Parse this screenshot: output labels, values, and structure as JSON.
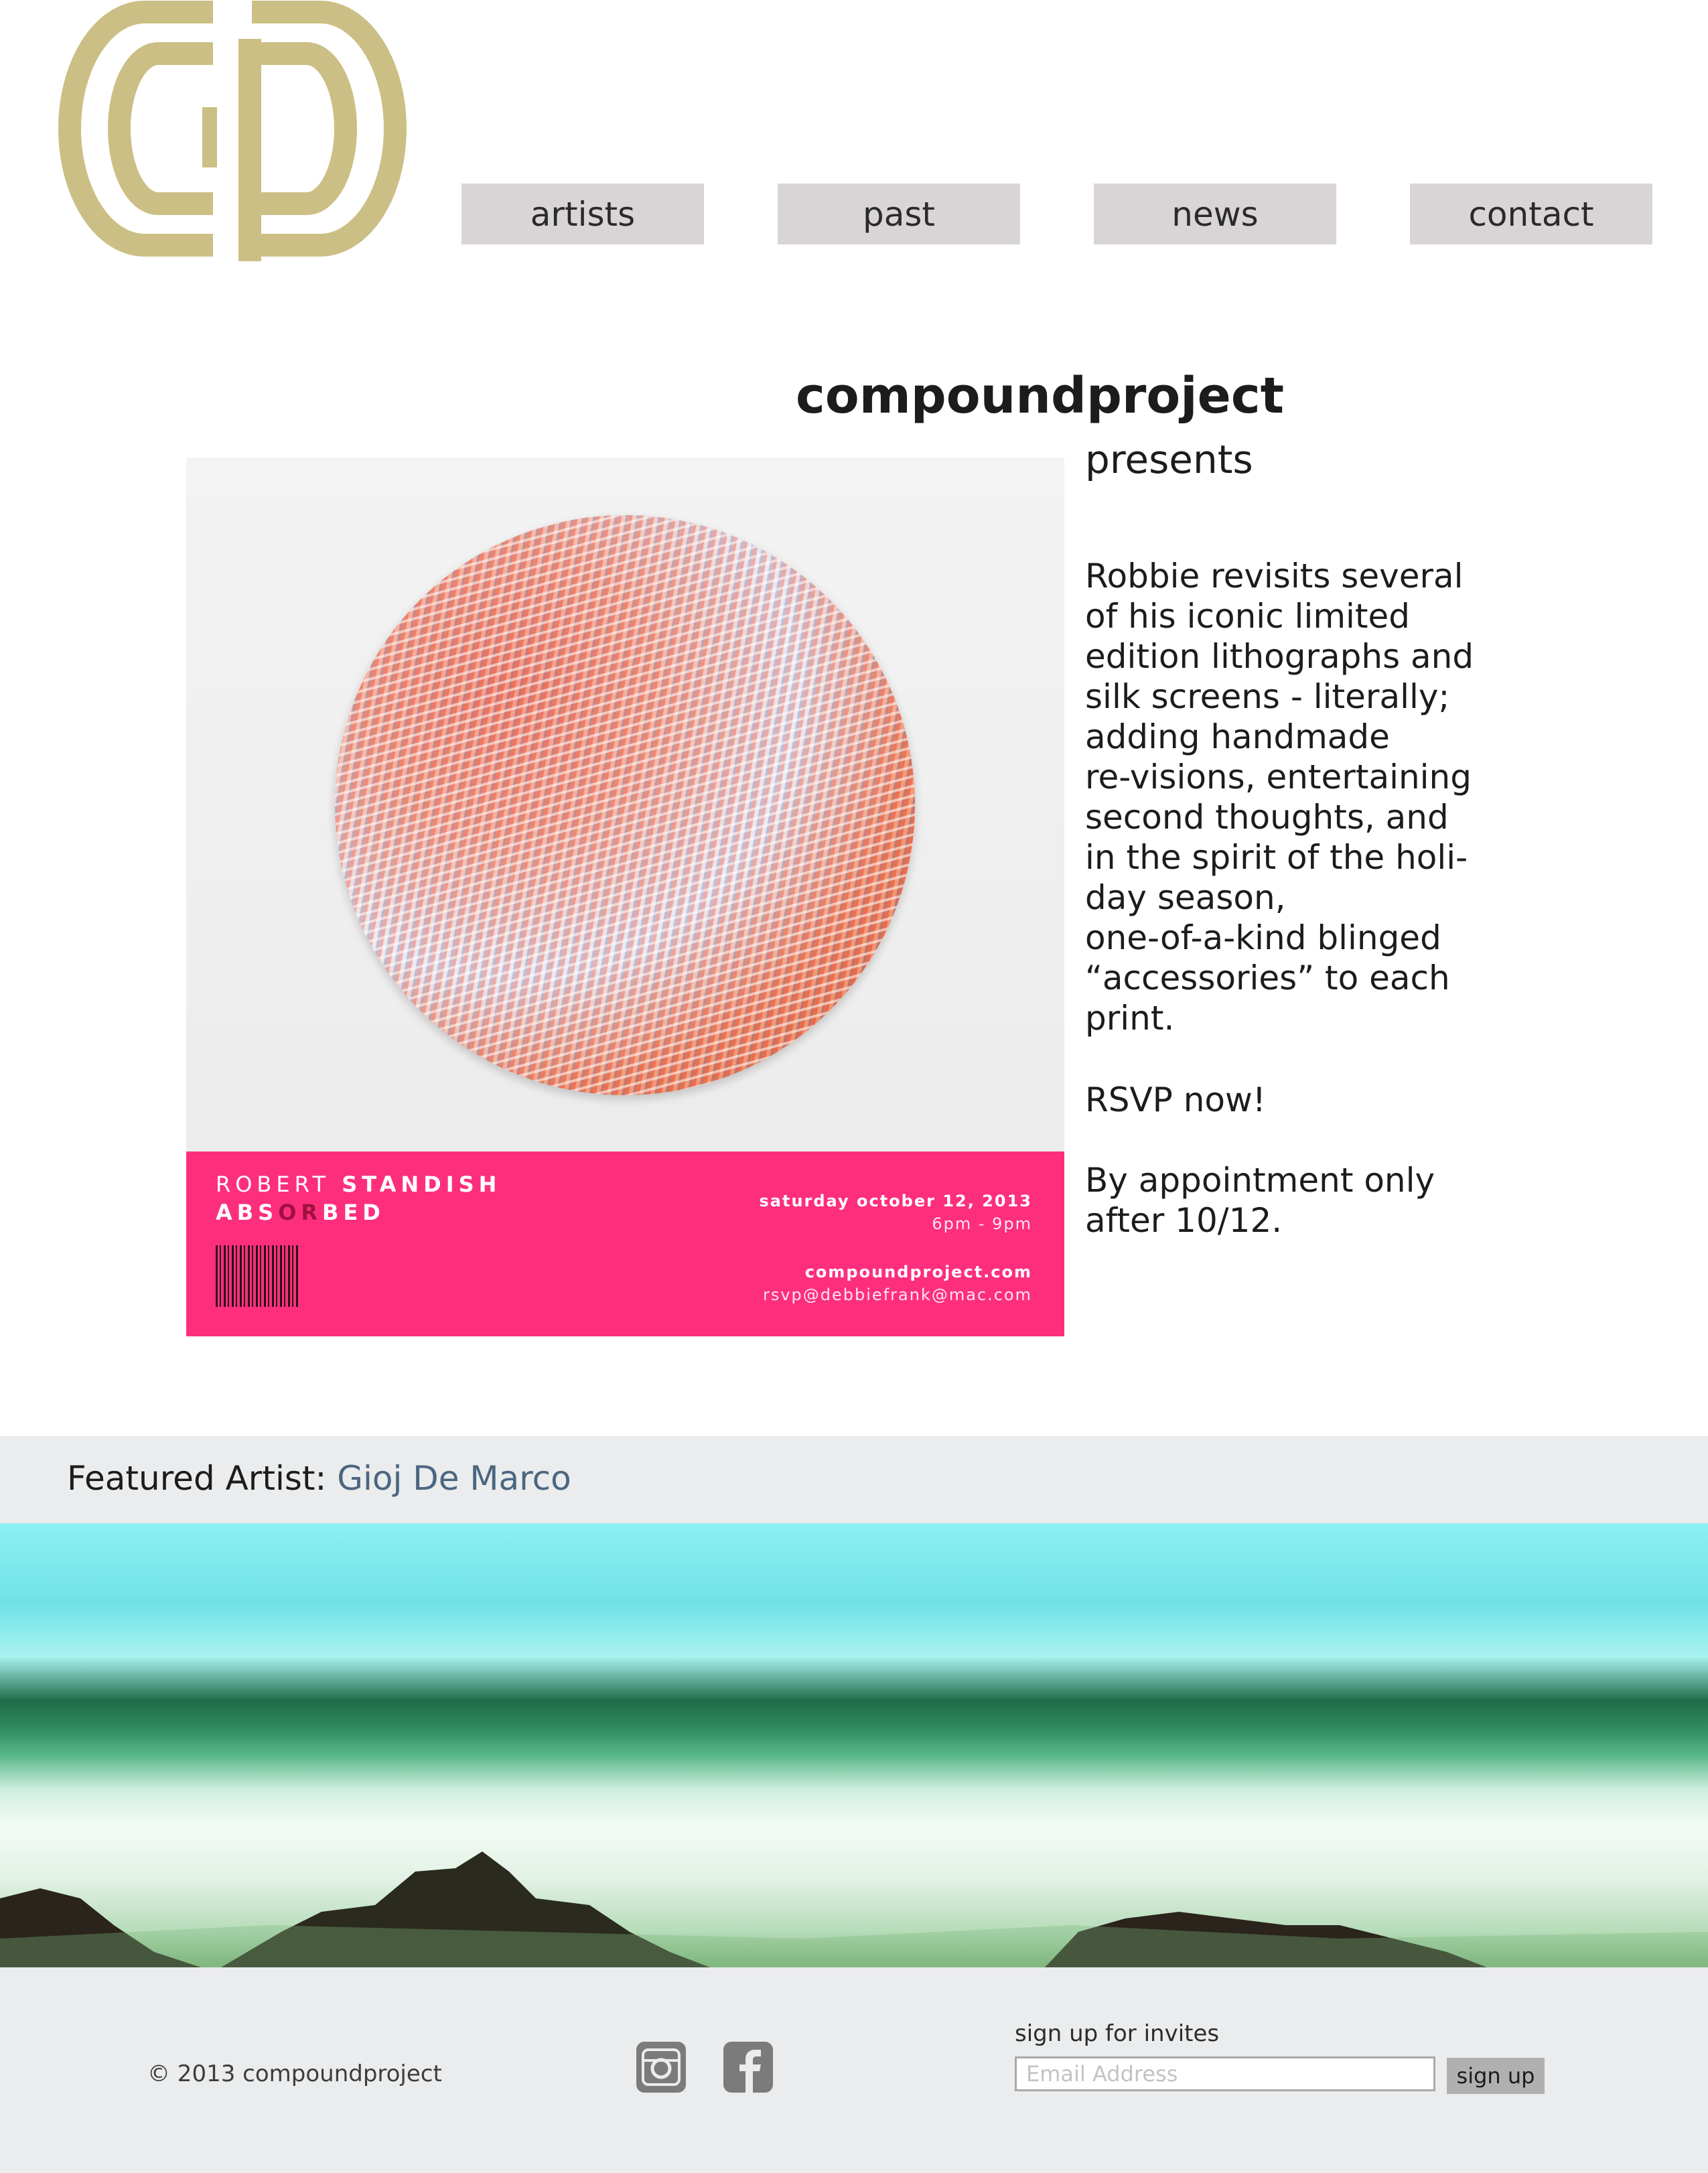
{
  "colors": {
    "logo": "#cbbf85",
    "nav_bg": "#d9d5d6",
    "accent_pink": "#fd2f7d",
    "featured_link": "#4c6680",
    "footer_bg": "#eaeced"
  },
  "logo": {
    "icon": "compoundproject-logo"
  },
  "nav": {
    "items": [
      {
        "label": "artists"
      },
      {
        "label": "past"
      },
      {
        "label": "news"
      },
      {
        "label": "contact"
      }
    ]
  },
  "hero": {
    "title": "compoundproject",
    "subtitle": "presents",
    "description": [
      "Robbie revisits several",
      "of his iconic limited",
      "edition lithographs and",
      "silk screens - literally;",
      "adding handmade",
      "re-visions, entertaining",
      "second thoughts, and",
      "in the spirit of the holi-",
      "day season,",
      "one-of-a-kind blinged",
      "“accessories” to each",
      "print."
    ],
    "rsvp": "RSVP now!",
    "appointment": [
      "By appointment only",
      "after 10/12."
    ]
  },
  "artwork": {
    "artist_first": "ROBERT",
    "artist_last": "STANDISH",
    "show_pre": "ABS",
    "show_mid": "OR",
    "show_post": "BED",
    "date": "saturday october 12, 2013",
    "time": "6pm - 9pm",
    "site": "compoundproject.com",
    "rsvp_email": "rsvp@debbiefrank@mac.com"
  },
  "featured": {
    "label": "Featured Artist:",
    "artist": "Gioj De Marco"
  },
  "footer": {
    "copyright": "© 2013 compoundproject",
    "social": [
      {
        "icon": "instagram-icon"
      },
      {
        "icon": "facebook-icon"
      }
    ],
    "signup_label": "sign up for invites",
    "email_placeholder": "Email Address",
    "signup_button": "sign up"
  }
}
